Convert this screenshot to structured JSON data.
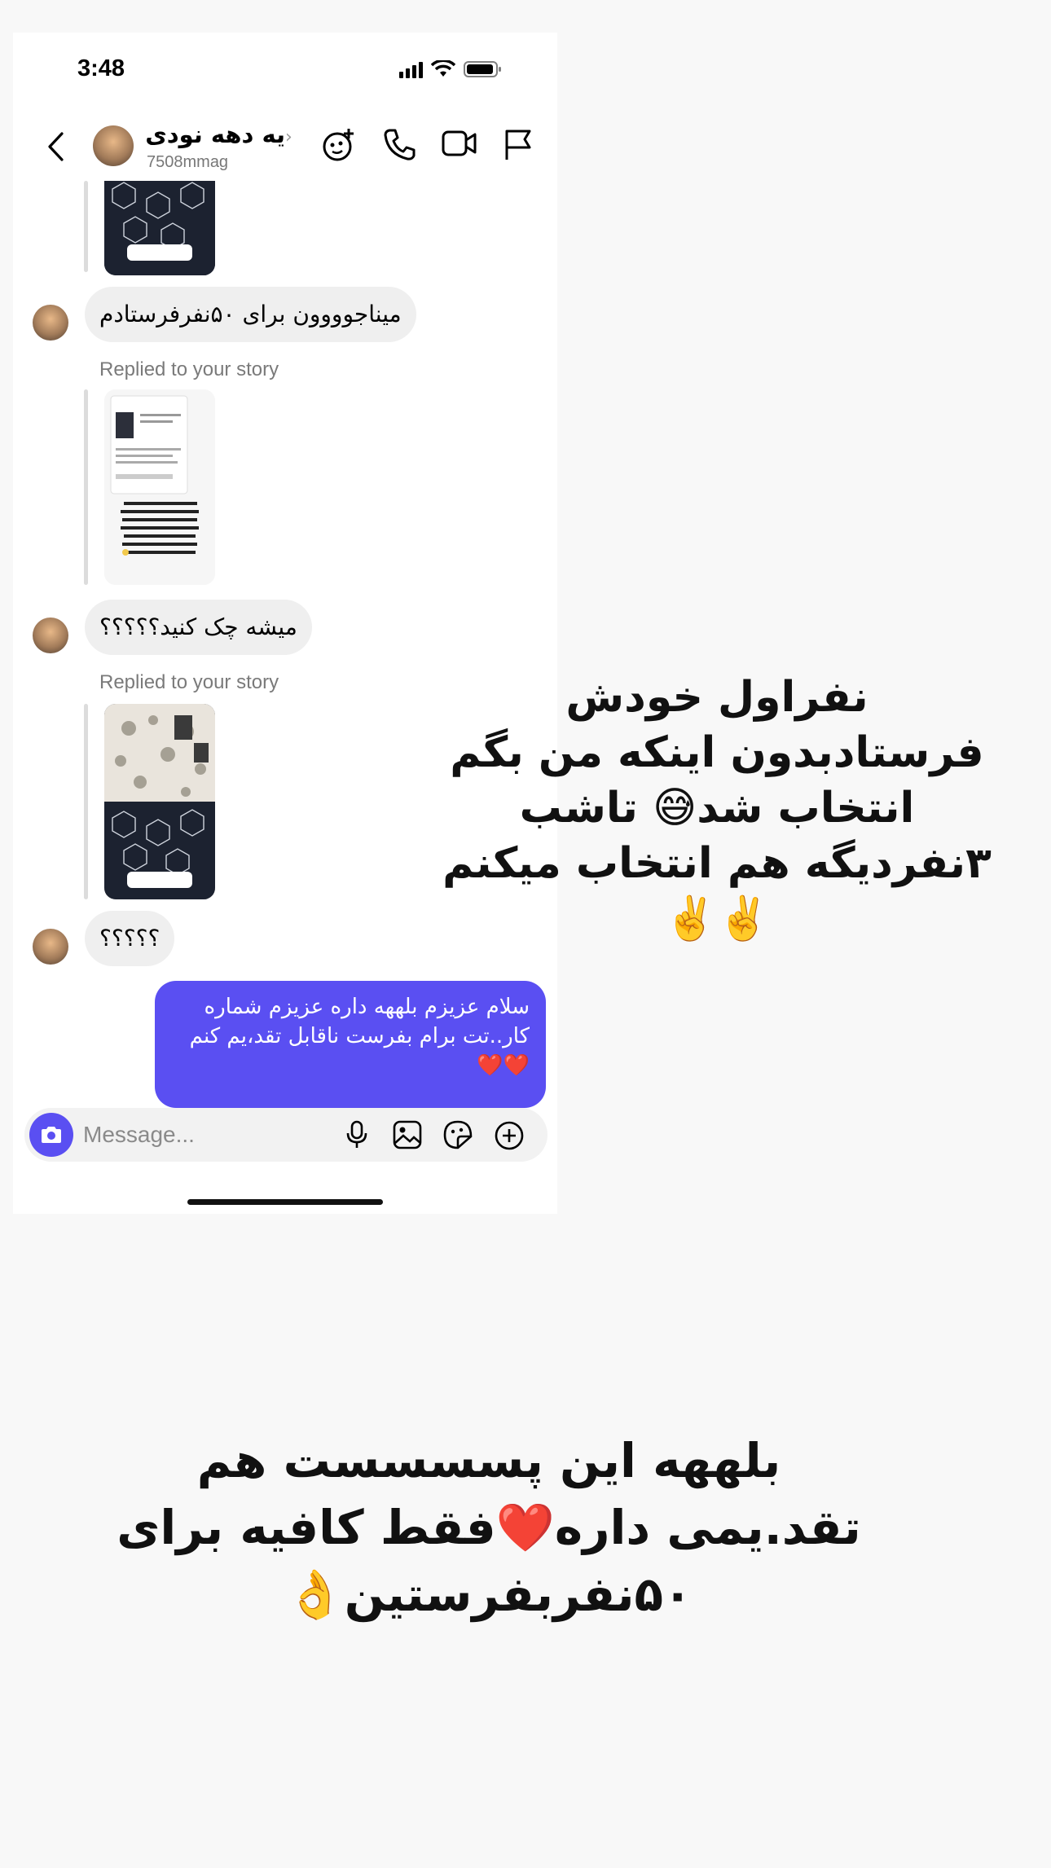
{
  "status_bar": {
    "time": "3:48"
  },
  "header": {
    "display_name": "یه دهه نودی",
    "username": "7508mmag",
    "chevron": "›",
    "icons": [
      "back-icon",
      "effects-icon",
      "phone-icon",
      "video-icon",
      "flag-icon"
    ]
  },
  "messages": {
    "m1_text": "میناجوووون برای ۵۰نفرفرستادم",
    "replied_label_1": "Replied to your story",
    "m2_text": "میشه چک کنید؟؟؟؟؟",
    "replied_label_2": "Replied to your story",
    "m3_text": "؟؟؟؟؟",
    "outgoing_text": "سلام عزیزم بلههه داره عزیزم شماره کار..تت برام بفرست ناقابل تقد،یم کنم ❤️❤️"
  },
  "story_texts": {
    "story_small": "من تا الان بهترین هارو بهتون معرفی کردم برای اینکه خودتون توی خونه یه در آمد بزنید",
    "story_caption": "پسسسستی که رو کلمش بیمانه"
  },
  "composer": {
    "placeholder": "Message...",
    "icons": [
      "camera-icon",
      "mic-icon",
      "gallery-icon",
      "sticker-icon",
      "plus-icon"
    ]
  },
  "overlays": {
    "caption_1": "نفراول خودش فرستادبدون اینکه من بگم انتخاب شد😅 تاشب ۳نفردیگه هم انتخاب میکنم✌️✌️",
    "caption_2": "بلههه این پسسسست هم تقد.یمی داره❤️فقط کافیه برای ۵۰نفربفرستین👌"
  },
  "colors": {
    "accent": "#5a4ff2",
    "incoming_bubble": "#efefef",
    "background": "#f8f8f8"
  }
}
